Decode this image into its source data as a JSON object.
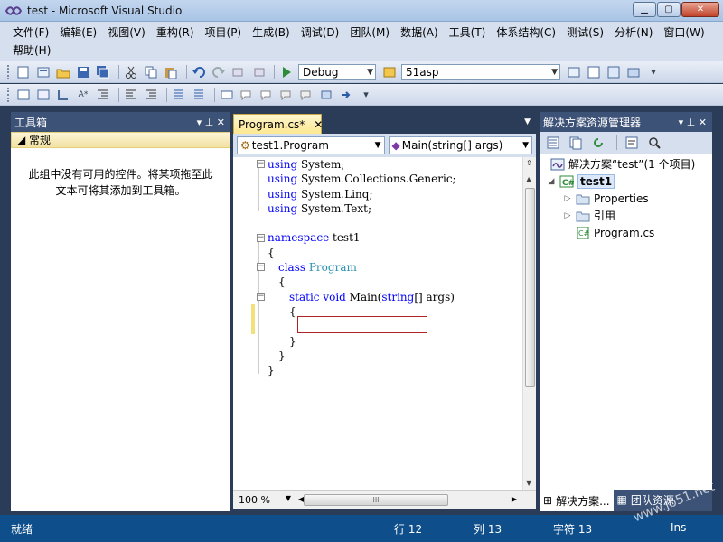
{
  "window": {
    "title": "test - Microsoft Visual Studio",
    "min_glyph": "▁",
    "max_glyph": "▢",
    "close_glyph": "✕"
  },
  "menu": {
    "items": [
      "文件(F)",
      "编辑(E)",
      "视图(V)",
      "重构(R)",
      "项目(P)",
      "生成(B)",
      "调试(D)",
      "团队(M)",
      "数据(A)",
      "工具(T)",
      "体系结构(C)",
      "测试(S)",
      "分析(N)",
      "窗口(W)",
      "帮助(H)"
    ]
  },
  "toolbar": {
    "config_combo": "Debug",
    "target_combo": "51asp"
  },
  "toolbox": {
    "title": "工具箱",
    "group": "常规",
    "empty_message": "此组中没有可用的控件。将某项拖至此文本可将其添加到工具箱。",
    "pin_glyph": "▾  ⊥  ✕"
  },
  "editor": {
    "tab_label": "Program.cs*",
    "tab_close": "✕",
    "class_combo": "test1.Program",
    "member_combo": "Main(string[] args)",
    "zoom": "100 %",
    "code": [
      {
        "kw": "using",
        "rest": " System;"
      },
      {
        "kw": "using",
        "rest": " System.Collections.Generic;"
      },
      {
        "kw": "using",
        "rest": " System.Linq;"
      },
      {
        "kw": "using",
        "rest": " System.Text;"
      },
      {
        "kw": "",
        "rest": ""
      },
      {
        "kw": "namespace",
        "rest": " test1"
      },
      {
        "kw": "",
        "rest": "{"
      },
      {
        "kw": "class",
        "ty": "Program"
      },
      {
        "kw": "",
        "rest": "{"
      },
      {
        "kw": "static void",
        "rest": " Main(",
        "kw2": "string",
        "rest2": "[] args)"
      },
      {
        "kw": "",
        "rest": "{"
      },
      {
        "kw": "",
        "rest": ""
      },
      {
        "kw": "",
        "rest": "}"
      },
      {
        "kw": "",
        "rest": "}"
      },
      {
        "kw": "",
        "rest": "}"
      }
    ]
  },
  "solution": {
    "title": "解决方案资源管理器",
    "root": "解决方案“test”(1 个项目)",
    "project": "test1",
    "properties": "Properties",
    "references": "引用",
    "file": "Program.cs",
    "tab1": "解决方案...",
    "tab2": "团队资源"
  },
  "status": {
    "ready": "就绪",
    "line": "行 12",
    "col": "列 13",
    "ch": "字符 13",
    "mode": "Ins"
  },
  "watermark": "www.jb51.net"
}
